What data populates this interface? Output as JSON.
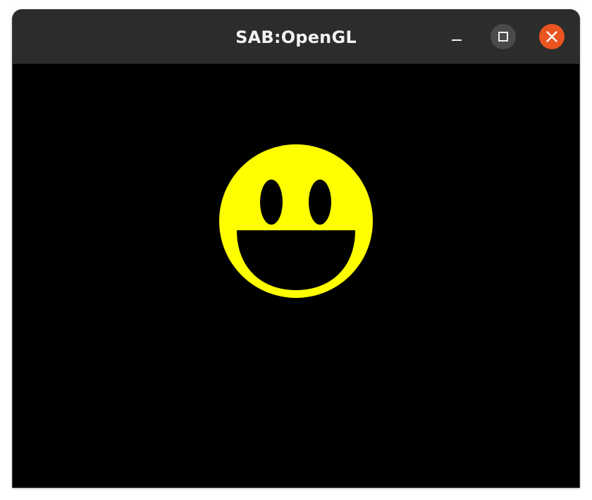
{
  "window": {
    "title": "SAB:OpenGL",
    "controls": {
      "minimize_icon": "minimize-icon",
      "maximize_icon": "maximize-icon",
      "close_icon": "close-icon"
    }
  },
  "scene": {
    "background_color": "#000000",
    "face_color": "#ffff00",
    "feature_color": "#000000",
    "icon": "smiley-face"
  },
  "theme": {
    "titlebar_color": "#2c2c2c",
    "close_button_color": "#e95420",
    "maximize_button_color": "#4a4a4a"
  }
}
